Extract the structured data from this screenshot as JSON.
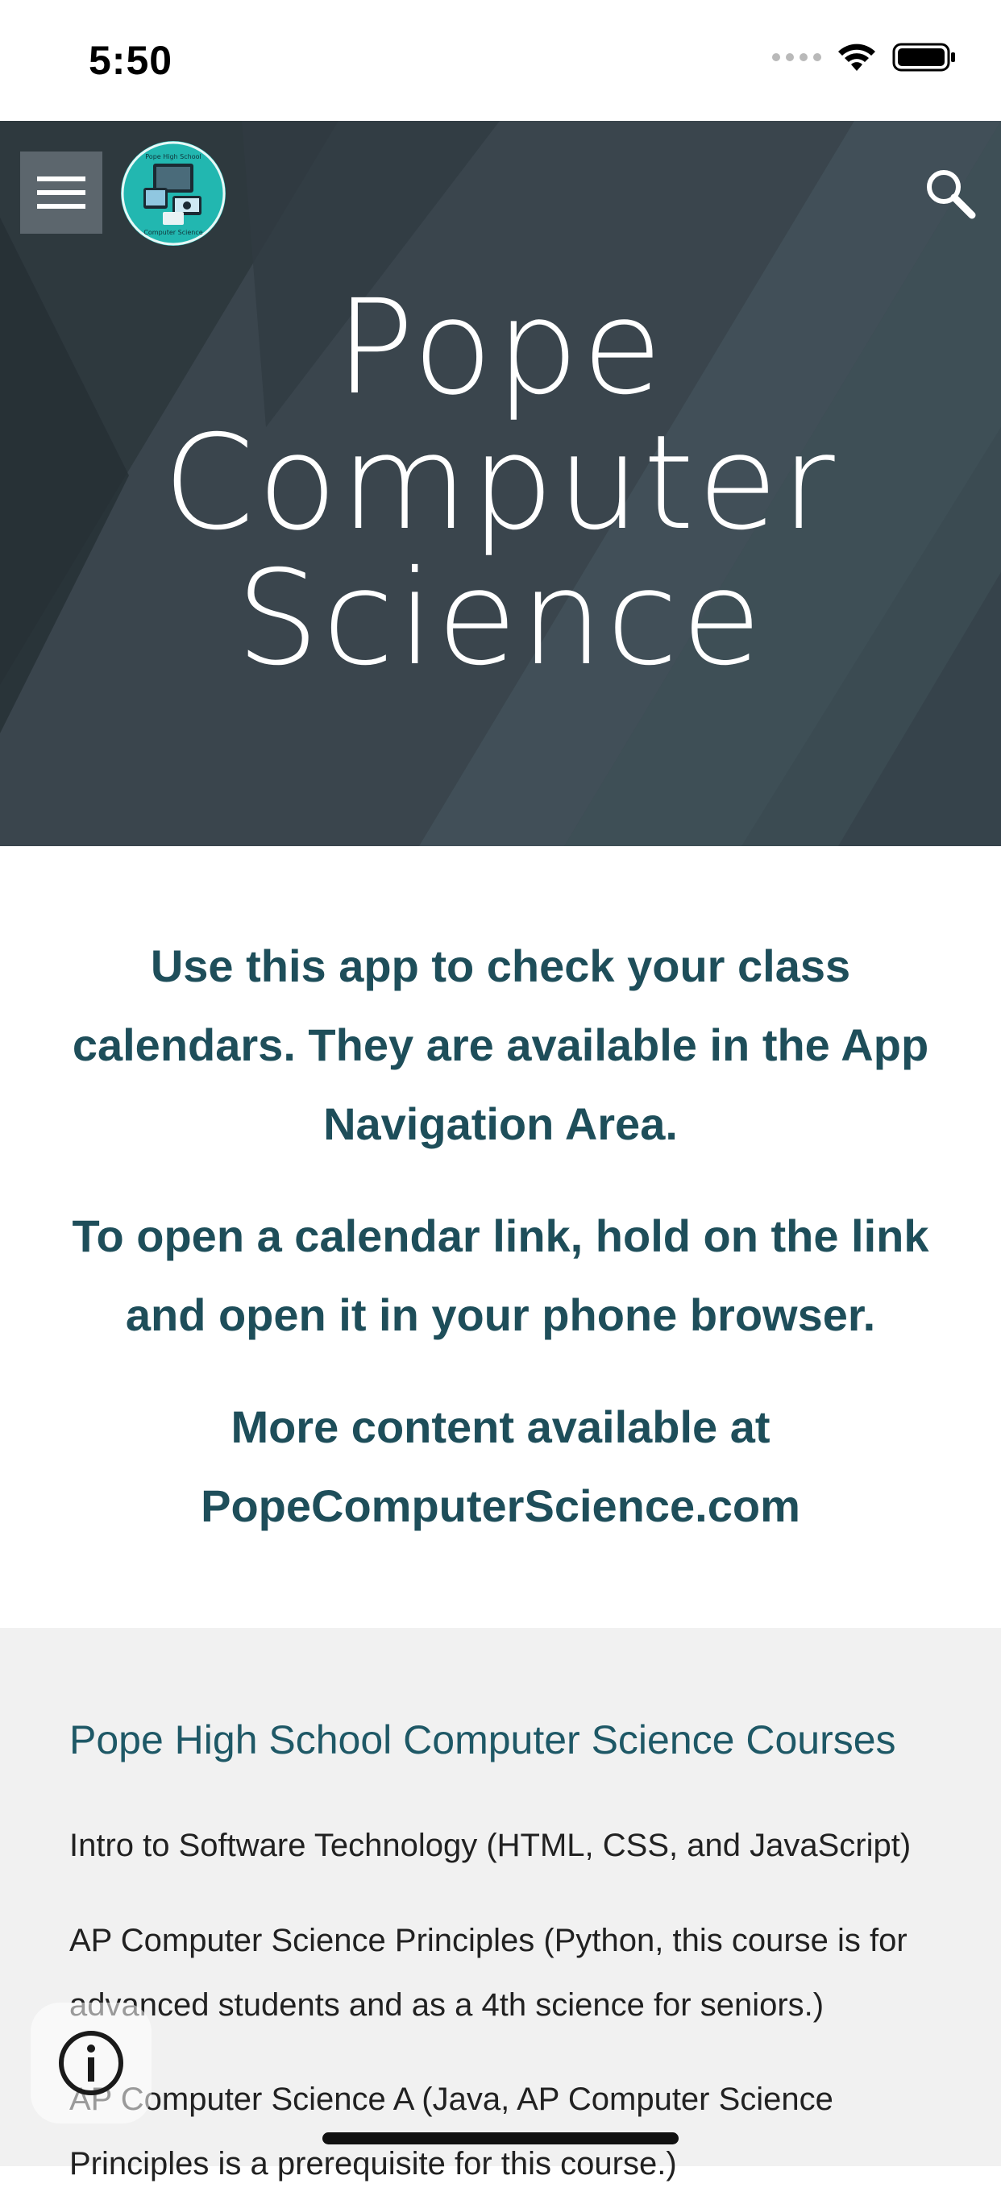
{
  "status_bar": {
    "time": "5:50",
    "icons": [
      "signal-dots-icon",
      "wifi-icon",
      "battery-icon"
    ]
  },
  "header": {
    "menu_icon": "hamburger-menu-icon",
    "logo": "Pope High School computer science logo",
    "logo_text_top": "Pope High School",
    "logo_text_bottom": "Computer Science",
    "search_icon": "search-icon",
    "title_lines": [
      "Pope",
      "Computer",
      "Science"
    ]
  },
  "intro": {
    "paragraph_1": "Use this app to check your class calendars. They are available in the App Navigation Area.",
    "paragraph_2": "To open a calendar link, hold on the link and open it in your phone browser.",
    "paragraph_3": "More content available at PopeComputerScience.com"
  },
  "courses": {
    "heading": "Pope High School Computer Science Courses",
    "items": [
      "Intro to Software Technology (HTML, CSS, and JavaScript)",
      "AP Computer Science Principles (Python, this course is for advanced students and as a 4th science for seniors.)",
      "AP Computer Science A (Java, AP Computer Science Principles is a prerequisite for this course.)"
    ]
  },
  "info_button_icon": "info-icon",
  "colors": {
    "hero_bg": "#37424a",
    "accent_text": "#1e4e5a",
    "courses_bg": "#f1f1f1"
  }
}
